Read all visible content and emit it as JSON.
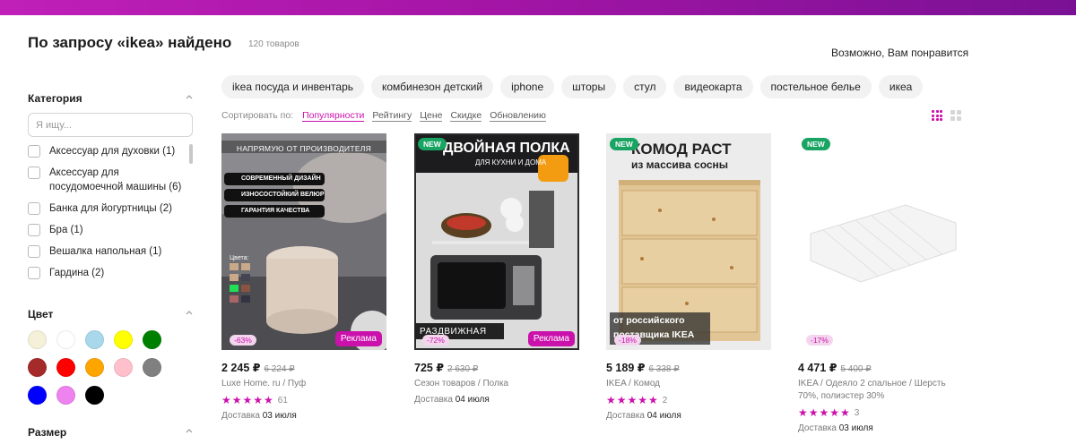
{
  "header": {
    "title": "По запросу «ikea» найдено",
    "count": "120 товаров",
    "maybe_like": "Возможно, Вам понравится"
  },
  "sidebar": {
    "category_title": "Категория",
    "search_placeholder": "Я ищу...",
    "categories": [
      {
        "label": "Аксессуар для духовки (1)"
      },
      {
        "label": "Аксессуар для посудомоечной машины (6)"
      },
      {
        "label": "Банка для йогуртницы (2)"
      },
      {
        "label": "Бра (1)"
      },
      {
        "label": "Вешалка напольная (1)"
      },
      {
        "label": "Гардина (2)"
      }
    ],
    "color_title": "Цвет",
    "colors": [
      "#f5f0d8",
      "#ffffff",
      "#a8d8ea",
      "#ffff00",
      "#008000",
      "#a52a2a",
      "#ff0000",
      "#ffa500",
      "#ffc0cb",
      "#808080",
      "#0000ff",
      "#ee82ee",
      "#000000"
    ],
    "size_title": "Размер"
  },
  "chips": [
    "ikea посуда и инвентарь",
    "комбинезон детский",
    "iphone",
    "шторы",
    "стул",
    "видеокарта",
    "постельное белье",
    "икеа"
  ],
  "sort": {
    "label": "Сортировать по:",
    "options": [
      "Популярности",
      "Рейтингу",
      "Цене",
      "Скидке",
      "Обновлению"
    ],
    "active": "Популярности"
  },
  "accent": "#cb11ab",
  "products": [
    {
      "new": "",
      "discount": "-63%",
      "ad": "Реклама",
      "price": "2 245 ₽",
      "old_price": "6 224 ₽",
      "brand": "Luxe Home. ru / Пуф",
      "rating_count": "61",
      "delivery_label": "Доставка",
      "delivery_date": "03 июля",
      "img_text": {
        "banner": "НАПРЯМУЮ ОТ ПРОИЗВОДИТЕЛЯ",
        "f1": "СОВРЕМЕННЫЙ ДИЗАЙН",
        "f2": "ИЗНОСОСТОЙКИЙ ВЕЛЮР",
        "f3": "ГАРАНТИЯ КАЧЕСТВА",
        "colors": "Цвета:"
      }
    },
    {
      "new": "NEW",
      "discount": "-72%",
      "ad": "Реклама",
      "price": "725 ₽",
      "old_price": "2 630 ₽",
      "brand": "Сезон товаров / Полка",
      "rating_count": "",
      "delivery_label": "Доставка",
      "delivery_date": "04 июля",
      "img_text": {
        "title": "ДВОЙНАЯ ПОЛКА",
        "subtitle": "ДЛЯ КУХНИ И ДОМА",
        "bottom": "РАЗДВИЖНАЯ"
      }
    },
    {
      "new": "NEW",
      "discount": "-18%",
      "ad": "",
      "price": "5 189 ₽",
      "old_price": "6 338 ₽",
      "brand": "IKEA / Комод",
      "rating_count": "2",
      "delivery_label": "Доставка",
      "delivery_date": "04 июля",
      "img_text": {
        "title": "КОМОД РАСТ",
        "subtitle": "из массива сосны",
        "bottom1": "от российского",
        "bottom2": "поставщика IKEA"
      }
    },
    {
      "new": "NEW",
      "discount": "-17%",
      "ad": "",
      "price": "4 471 ₽",
      "old_price": "5 400 ₽",
      "brand": "IKEA / Одеяло 2 спальное / Шерсть 70%, полиэстер 30%",
      "rating_count": "3",
      "delivery_label": "Доставка",
      "delivery_date": "03 июля",
      "img_text": {}
    }
  ]
}
